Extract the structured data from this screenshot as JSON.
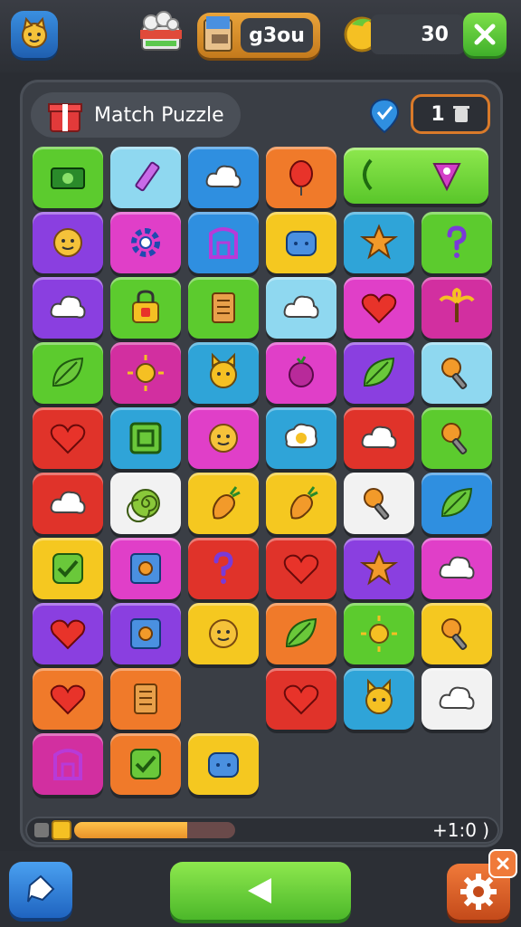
{
  "header": {
    "score": "g3ou",
    "coins": "30"
  },
  "panel": {
    "title": "Match Puzzle",
    "moves": "1"
  },
  "progress": {
    "fill": 0.7,
    "timer": "+1:0 )"
  },
  "colors": {
    "green": "#5ccb2e",
    "blue": "#2f8fe0",
    "purple": "#8a3fe0",
    "pink": "#e03fc8",
    "orange": "#f07a2a",
    "red": "#e0332a",
    "yellow": "#f5c820",
    "teal": "#2fa4d8",
    "lightblue": "#8fd8f0",
    "white": "#f2f2f2",
    "magenta": "#d22fa0"
  },
  "tiles": [
    {
      "color": "green",
      "icon": "money-icon"
    },
    {
      "color": "lightblue",
      "icon": "pencil-icon"
    },
    {
      "color": "blue",
      "icon": "cloud-icon"
    },
    {
      "color": "orange",
      "icon": "balloon-icon"
    },
    {
      "color": "red",
      "icon": "face-icon"
    },
    {
      "color": "lightblue",
      "icon": "key-icon"
    },
    {
      "color": "purple",
      "icon": "face-icon"
    },
    {
      "color": "pink",
      "icon": "gear-icon"
    },
    {
      "color": "blue",
      "icon": "door-icon"
    },
    {
      "color": "yellow",
      "icon": "bread-icon"
    },
    {
      "color": "teal",
      "icon": "star-icon"
    },
    {
      "color": "green",
      "icon": "question-icon"
    },
    {
      "color": "purple",
      "icon": "cloud-icon"
    },
    {
      "color": "green",
      "icon": "lock-icon"
    },
    {
      "color": "green",
      "icon": "scroll-icon"
    },
    {
      "color": "lightblue",
      "icon": "cloud-icon"
    },
    {
      "color": "pink",
      "icon": "heart-icon"
    },
    {
      "color": "magenta",
      "icon": "palm-icon"
    },
    {
      "color": "green",
      "icon": "leaf-icon"
    },
    {
      "color": "magenta",
      "icon": "sun-icon"
    },
    {
      "color": "teal",
      "icon": "cat-icon"
    },
    {
      "color": "pink",
      "icon": "berry-icon"
    },
    {
      "color": "purple",
      "icon": "leaf-icon"
    },
    {
      "color": "lightblue",
      "icon": "key-icon"
    },
    {
      "color": "red",
      "icon": "heart-icon"
    },
    {
      "color": "teal",
      "icon": "frame-icon"
    },
    {
      "color": "pink",
      "icon": "face-icon"
    },
    {
      "color": "teal",
      "icon": "egg-icon"
    },
    {
      "color": "red",
      "icon": "cloud-icon"
    },
    {
      "color": "green",
      "icon": "key-icon"
    },
    {
      "color": "red",
      "icon": "cloud-icon"
    },
    {
      "color": "white",
      "icon": "spiral-icon"
    },
    {
      "color": "yellow",
      "icon": "carrot-icon"
    },
    {
      "color": "yellow",
      "icon": "carrot-icon"
    },
    {
      "color": "white",
      "icon": "key-icon"
    },
    {
      "color": "blue",
      "icon": "leaf-icon"
    },
    {
      "color": "yellow",
      "icon": "check-icon"
    },
    {
      "color": "pink",
      "icon": "safe-icon"
    },
    {
      "color": "red",
      "icon": "question-icon"
    },
    {
      "color": "red",
      "icon": "heart-icon"
    },
    {
      "color": "purple",
      "icon": "star-icon"
    },
    {
      "color": "pink",
      "icon": "cloud-icon"
    },
    {
      "color": "purple",
      "icon": "heart-icon"
    },
    {
      "color": "purple",
      "icon": "safe-icon"
    },
    {
      "color": "yellow",
      "icon": "face-icon"
    },
    {
      "color": "orange",
      "icon": "leaf-icon"
    },
    {
      "color": "green",
      "icon": "sun-icon"
    },
    {
      "color": "yellow",
      "icon": "key-icon"
    },
    {
      "color": "orange",
      "icon": "heart-icon"
    },
    {
      "color": "orange",
      "icon": "scroll-icon"
    },
    {
      "color": "",
      "icon": ""
    },
    {
      "color": "red",
      "icon": "heart-icon"
    },
    {
      "color": "teal",
      "icon": "cat-icon"
    },
    {
      "color": "white",
      "icon": "cloud-icon"
    },
    {
      "color": "magenta",
      "icon": "door-icon"
    },
    {
      "color": "orange",
      "icon": "check-icon"
    },
    {
      "color": "yellow",
      "icon": "bread-icon"
    },
    {
      "color": "",
      "icon": ""
    }
  ]
}
